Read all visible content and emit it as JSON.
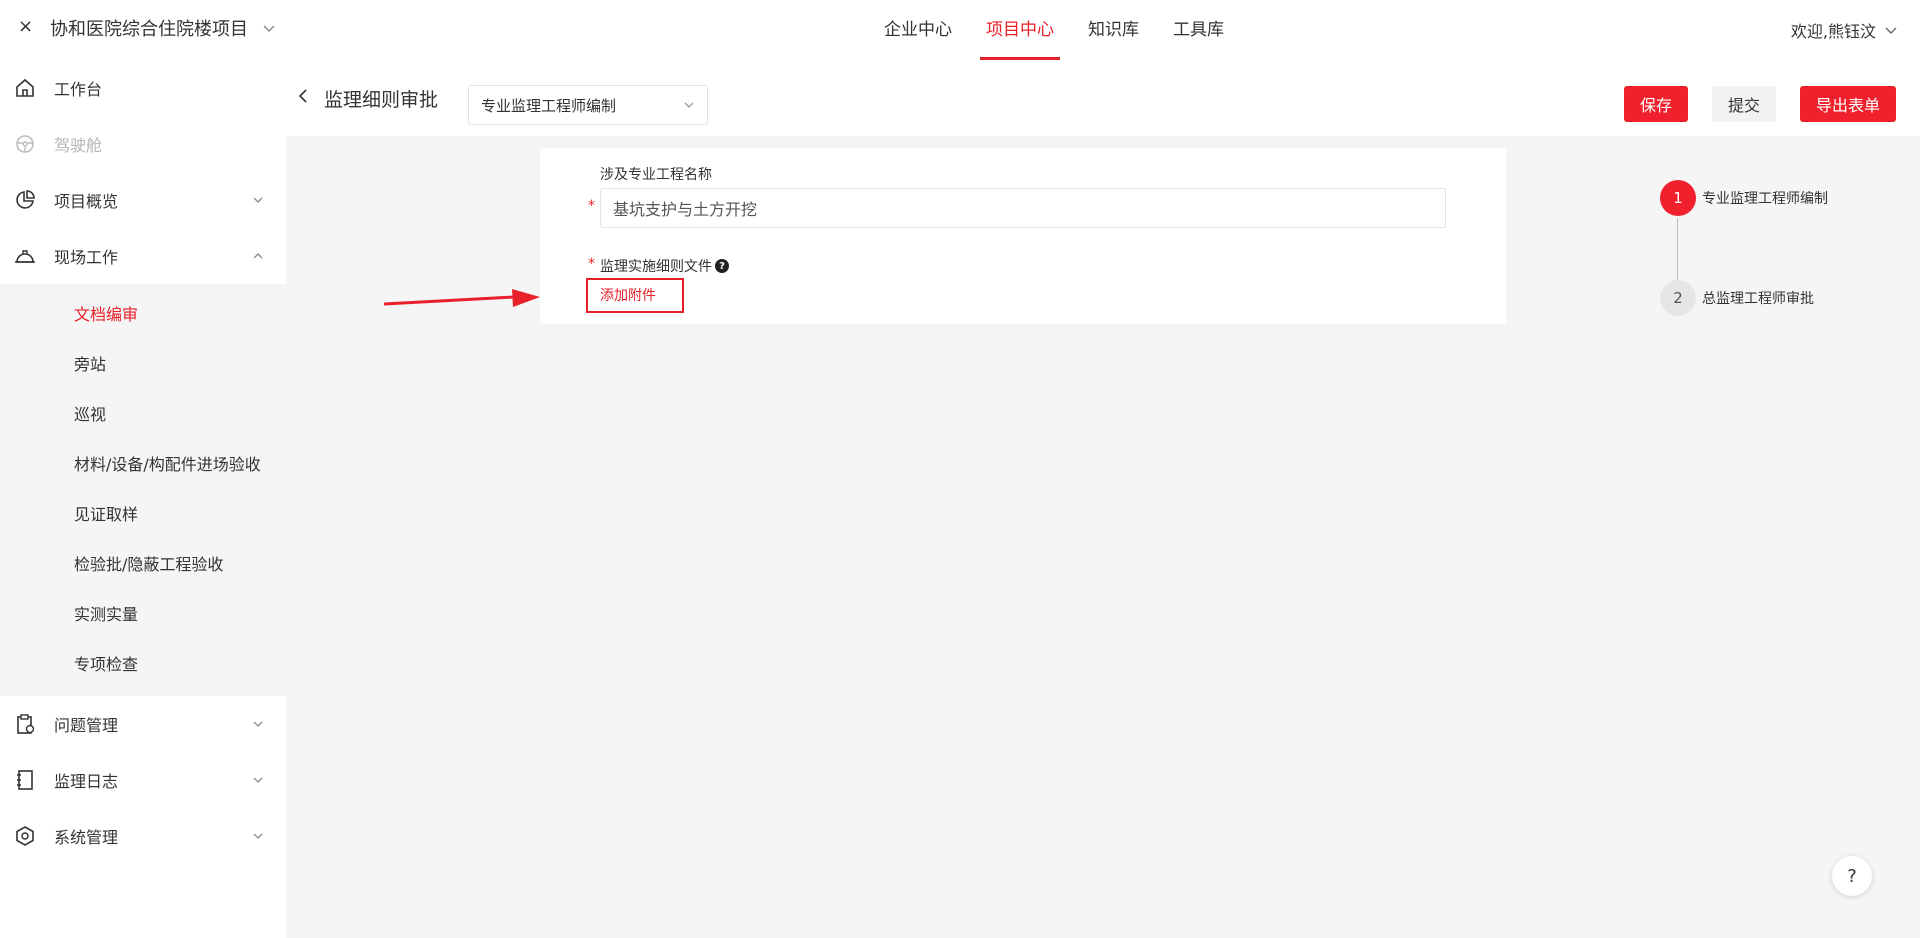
{
  "topbar": {
    "close_symbol": "×",
    "project_name": "协和医院综合住院楼项目",
    "nav": [
      {
        "label": "企业中心"
      },
      {
        "label": "项目中心"
      },
      {
        "label": "知识库"
      },
      {
        "label": "工具库"
      }
    ],
    "active_nav": "项目中心",
    "welcome": "欢迎,熊钰汶"
  },
  "sidebar": {
    "items": [
      {
        "label": "工作台",
        "icon": "home-icon"
      },
      {
        "label": "驾驶舱",
        "icon": "steering-wheel-icon",
        "disabled": true
      },
      {
        "label": "项目概览",
        "icon": "pie-chart-icon"
      },
      {
        "label": "现场工作",
        "icon": "hard-hat-icon",
        "expanded": true
      },
      {
        "label": "问题管理",
        "icon": "clipboard-icon"
      },
      {
        "label": "监理日志",
        "icon": "notebook-icon"
      },
      {
        "label": "系统管理",
        "icon": "hex-gear-icon"
      }
    ],
    "sub_items": [
      {
        "label": "文档编审"
      },
      {
        "label": "旁站"
      },
      {
        "label": "巡视"
      },
      {
        "label": "材料/设备/构配件进场验收"
      },
      {
        "label": "见证取样"
      },
      {
        "label": "检验批/隐蔽工程验收"
      },
      {
        "label": "实测实量"
      },
      {
        "label": "专项检查"
      }
    ],
    "active_sub": "文档编审"
  },
  "header": {
    "title": "监理细则审批",
    "stage_select": "专业监理工程师编制",
    "save_label": "保存",
    "submit_label": "提交",
    "export_label": "导出表单"
  },
  "form": {
    "project_name_label": "涉及专业工程名称",
    "project_name_value": "基坑支护与土方开挖",
    "file_label": "监理实施细则文件",
    "add_file_label": "添加附件",
    "required_mark": "*",
    "help_symbol": "?"
  },
  "steps": [
    {
      "num": "1",
      "label": "专业监理工程师编制",
      "status": "active"
    },
    {
      "num": "2",
      "label": "总监理工程师审批",
      "status": "pending"
    }
  ],
  "help_fab": "?",
  "colors": {
    "accent": "#e8202a",
    "background": "#f5f5f5"
  }
}
